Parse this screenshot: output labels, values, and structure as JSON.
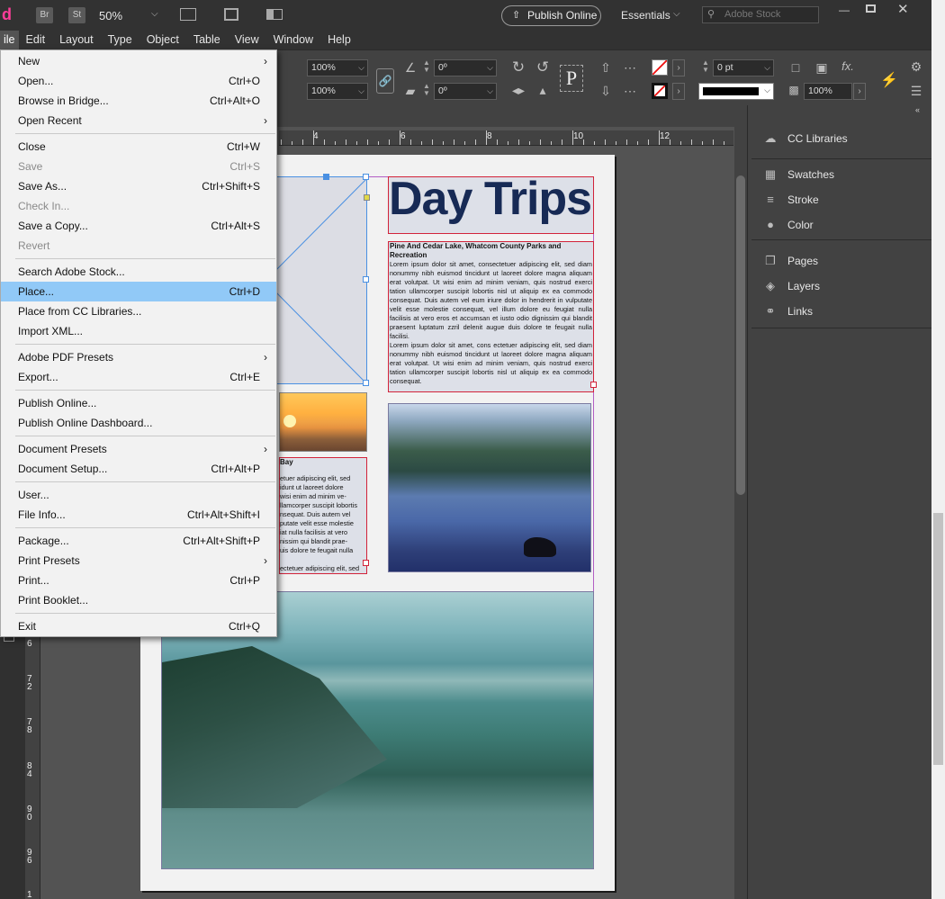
{
  "app": {
    "logo": "d",
    "bridge": "Br",
    "stock_badge": "St",
    "zoom": "50%",
    "publish_online": "Publish Online",
    "workspace": "Essentials",
    "search_placeholder": "Adobe Stock"
  },
  "menubar": [
    "ile",
    "Edit",
    "Layout",
    "Type",
    "Object",
    "Table",
    "View",
    "Window",
    "Help"
  ],
  "control": {
    "scale_x": "100%",
    "scale_y": "100%",
    "angle": "0º",
    "shear": "0º",
    "stroke_weight": "0 pt",
    "opacity": "100%",
    "text_glyph": "P",
    "fx": "fx."
  },
  "ruler": {
    "h": [
      "4",
      "6",
      "8",
      "10",
      "12"
    ],
    "v": [
      "6",
      "7\n2",
      "7\n8",
      "8\n4",
      "9\n0",
      "9\n6",
      "1"
    ]
  },
  "panels": {
    "group1": [
      {
        "label": "CC Libraries",
        "icon": "cloud-icon"
      }
    ],
    "group2": [
      {
        "label": "Swatches",
        "icon": "swatches-icon"
      },
      {
        "label": "Stroke",
        "icon": "stroke-icon"
      },
      {
        "label": "Color",
        "icon": "palette-icon"
      }
    ],
    "group3": [
      {
        "label": "Pages",
        "icon": "pages-icon"
      },
      {
        "label": "Layers",
        "icon": "layers-icon"
      },
      {
        "label": "Links",
        "icon": "links-icon"
      }
    ]
  },
  "document": {
    "title": "Day Trips",
    "article_heading": "Pine And Cedar Lake, Whatcom County Parks and Recreation",
    "article_body": "Lorem ipsum dolor sit amet, consectetuer adipiscing elit, sed diam nonummy nibh euismod tincidunt ut laoreet dolore magna aliquam erat volutpat. Ut wisi enim ad minim veniam, quis nostrud exerci tation ullamcorper suscipit lobortis nisl ut aliquip ex ea commodo consequat. Duis autem vel eum iriure dolor in hendrerit in vulputate velit esse molestie consequat, vel illum dolore eu feugiat nulla facilisis at vero eros et accumsan et iusto odio dignissim qui blandit praesent luptatum zzril delenit augue duis dolore te feugait nulla facilisi.\nLorem ipsum dolor sit amet, cons ectetuer adipiscing elit, sed diam nonummy nibh euismod tincidunt ut laoreet dolore magna aliquam erat volutpat. Ut wisi enim ad minim veniam, quis nostrud exerci tation ullamcorper suscipit lobortis nisl ut aliquip ex ea commodo consequat.",
    "left_heading": "Bay",
    "left_body": "etuer adipiscing elit, sed\nidunt ut laoreet dolore\nwisi enim ad minim ve-\nllamcorper suscipit lobortis\nnsequat. Duis autem vel\nputate velit esse molestie\niat nulla facilisis at vero\nnissim qui blandit prae-\nuis dolore te feugait nulla\n\nectetuer adipiscing elit, sed"
  },
  "file_menu": [
    {
      "label": "New",
      "shortcut": "",
      "submenu": true
    },
    {
      "label": "Open...",
      "shortcut": "Ctrl+O"
    },
    {
      "label": "Browse in Bridge...",
      "shortcut": "Ctrl+Alt+O"
    },
    {
      "label": "Open Recent",
      "shortcut": "",
      "submenu": true
    },
    {
      "sep": true
    },
    {
      "label": "Close",
      "shortcut": "Ctrl+W"
    },
    {
      "label": "Save",
      "shortcut": "Ctrl+S",
      "disabled": true
    },
    {
      "label": "Save As...",
      "shortcut": "Ctrl+Shift+S"
    },
    {
      "label": "Check In...",
      "shortcut": "",
      "disabled": true
    },
    {
      "label": "Save a Copy...",
      "shortcut": "Ctrl+Alt+S"
    },
    {
      "label": "Revert",
      "shortcut": "",
      "disabled": true
    },
    {
      "sep": true
    },
    {
      "label": "Search Adobe Stock...",
      "shortcut": ""
    },
    {
      "label": "Place...",
      "shortcut": "Ctrl+D",
      "highlighted": true
    },
    {
      "label": "Place from CC Libraries...",
      "shortcut": ""
    },
    {
      "label": "Import XML...",
      "shortcut": ""
    },
    {
      "sep": true
    },
    {
      "label": "Adobe PDF Presets",
      "shortcut": "",
      "submenu": true
    },
    {
      "label": "Export...",
      "shortcut": "Ctrl+E"
    },
    {
      "sep": true
    },
    {
      "label": "Publish Online...",
      "shortcut": ""
    },
    {
      "label": "Publish Online Dashboard...",
      "shortcut": ""
    },
    {
      "sep": true
    },
    {
      "label": "Document Presets",
      "shortcut": "",
      "submenu": true
    },
    {
      "label": "Document Setup...",
      "shortcut": "Ctrl+Alt+P"
    },
    {
      "sep": true
    },
    {
      "label": "User...",
      "shortcut": ""
    },
    {
      "label": "File Info...",
      "shortcut": "Ctrl+Alt+Shift+I"
    },
    {
      "sep": true
    },
    {
      "label": "Package...",
      "shortcut": "Ctrl+Alt+Shift+P"
    },
    {
      "label": "Print Presets",
      "shortcut": "",
      "submenu": true
    },
    {
      "label": "Print...",
      "shortcut": "Ctrl+P"
    },
    {
      "label": "Print Booklet...",
      "shortcut": ""
    },
    {
      "sep": true
    },
    {
      "label": "Exit",
      "shortcut": "Ctrl+Q"
    }
  ]
}
